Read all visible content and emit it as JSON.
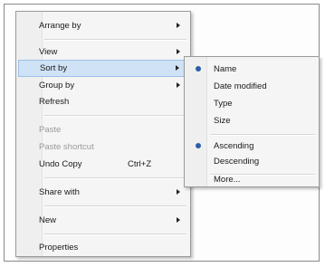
{
  "context_menu": {
    "items": [
      {
        "label": "Arrange by"
      },
      {
        "label": "View"
      },
      {
        "label": "Sort by"
      },
      {
        "label": "Group by"
      },
      {
        "label": "Refresh"
      },
      {
        "label": "Paste"
      },
      {
        "label": "Paste shortcut"
      },
      {
        "label": "Undo Copy",
        "shortcut": "Ctrl+Z"
      },
      {
        "label": "Share with"
      },
      {
        "label": "New"
      },
      {
        "label": "Properties"
      }
    ]
  },
  "sort_submenu": {
    "items": [
      {
        "label": "Name",
        "selected": true
      },
      {
        "label": "Date modified"
      },
      {
        "label": "Type"
      },
      {
        "label": "Size"
      },
      {
        "label": "Ascending",
        "selected": true
      },
      {
        "label": "Descending"
      },
      {
        "label": "More..."
      }
    ]
  },
  "colors": {
    "highlight": "#cfe2f6",
    "radio_bullet": "#2a5ea8",
    "disabled_text": "#9a9a9a"
  }
}
